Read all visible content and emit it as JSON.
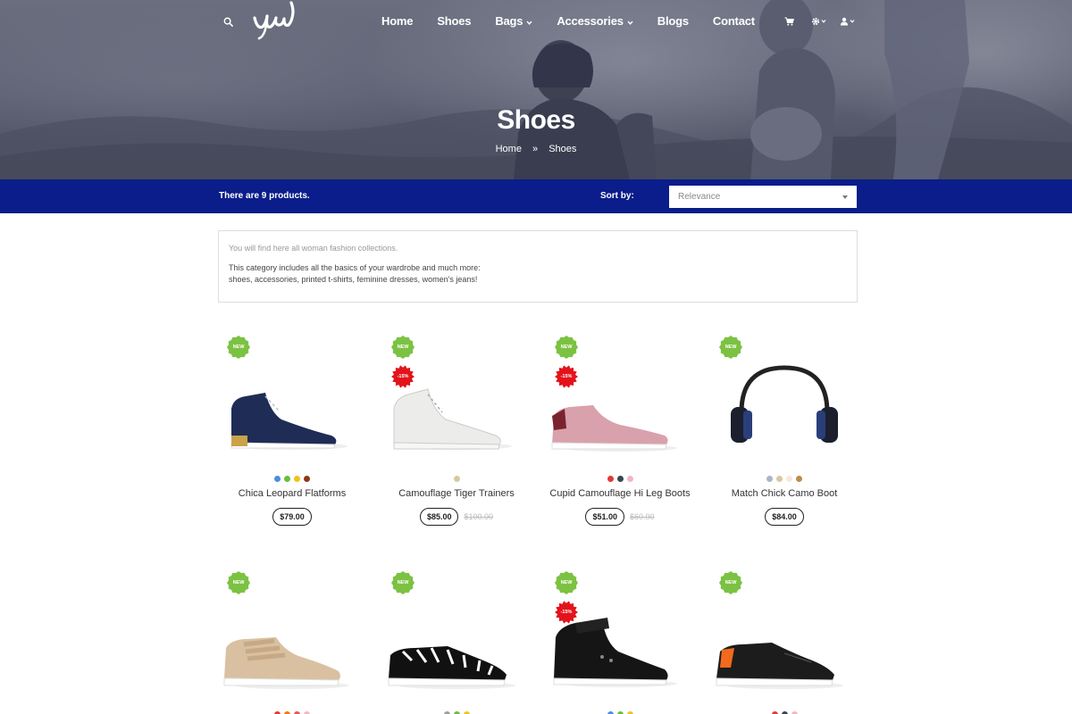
{
  "header": {
    "logo_text": "yew",
    "menu": [
      {
        "label": "Home",
        "dropdown": false
      },
      {
        "label": "Shoes",
        "dropdown": false
      },
      {
        "label": "Bags",
        "dropdown": true
      },
      {
        "label": "Accessories",
        "dropdown": true
      },
      {
        "label": "Blogs",
        "dropdown": false
      },
      {
        "label": "Contact",
        "dropdown": false
      }
    ],
    "icons": [
      "search-icon",
      "cart-icon",
      "settings-icon",
      "user-icon"
    ]
  },
  "hero": {
    "title": "Shoes",
    "breadcrumb": [
      "Home",
      "Shoes"
    ]
  },
  "toolbar": {
    "count_text": "There are 9 products.",
    "sort_label": "Sort by:",
    "sort_value": "Relevance"
  },
  "description": {
    "line1": "You will find here all woman fashion collections.",
    "line2": "This category includes all the basics of your wardrobe and much more:",
    "line3": "shoes, accessories, printed t-shirts, feminine dresses, women's jeans!"
  },
  "products": [
    {
      "name": "Chica Leopard Flatforms",
      "price": "$79.00",
      "old_price": "",
      "new_label": "NEW",
      "discount": "",
      "swatches": [
        "#4a8fe0",
        "#6bbf3a",
        "#f1c21b",
        "#8a3a12"
      ],
      "image": "navy-high-top"
    },
    {
      "name": "Camouflage Tiger Trainers",
      "price": "$85.00",
      "old_price": "$100.00",
      "new_label": "NEW",
      "discount": "-15%",
      "swatches": [
        "#d8c9a0"
      ],
      "image": "white-high-top"
    },
    {
      "name": "Cupid Camouflage Hi Leg Boots",
      "price": "$51.00",
      "old_price": "$60.00",
      "new_label": "NEW",
      "discount": "-15%",
      "swatches": [
        "#e53935",
        "#37474f",
        "#f4b6c2"
      ],
      "image": "pink-sneaker"
    },
    {
      "name": "Match Chick Camo Boot",
      "price": "$84.00",
      "old_price": "",
      "new_label": "NEW",
      "discount": "",
      "swatches": [
        "#a9b4c8",
        "#d8c9a0",
        "#f3eadc",
        "#c08a4a"
      ],
      "image": "headphones"
    },
    {
      "name": "",
      "price": "",
      "old_price": "",
      "new_label": "NEW",
      "discount": "",
      "swatches": [
        "#e53935",
        "#f57c00",
        "#ef5350",
        "#f4b6c2"
      ],
      "image": "beige-velcro"
    },
    {
      "name": "",
      "price": "",
      "old_price": "",
      "new_label": "NEW",
      "discount": "",
      "swatches": [
        "#9e9e9e",
        "#6bbf3a",
        "#f1c21b"
      ],
      "image": "zebra-slipon"
    },
    {
      "name": "",
      "price": "",
      "old_price": "",
      "new_label": "NEW",
      "discount": "-15%",
      "swatches": [
        "#4a8fe0",
        "#6bbf3a",
        "#f1c21b"
      ],
      "image": "black-high-top"
    },
    {
      "name": "",
      "price": "",
      "old_price": "",
      "new_label": "NEW",
      "discount": "",
      "swatches": [
        "#e53935",
        "#37474f",
        "#f4b6c2"
      ],
      "image": "black-orange-runner"
    }
  ],
  "colors": {
    "nav_bar": "#0a1d8a",
    "new_badge": "#7cc242",
    "sale_badge": "#e3131b"
  }
}
